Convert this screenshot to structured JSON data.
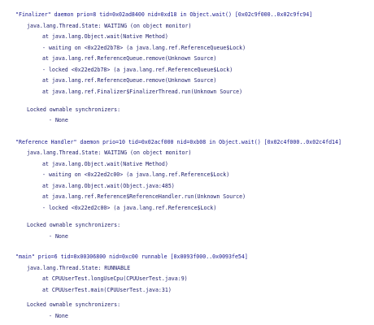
{
  "threads": [
    {
      "header": "\"Finalizer\" daemon prio=8 tid=0x02ad8400 nid=0xd18 in Object.wait() [0x02c9f000..0x02c9fc94]",
      "state": "java.lang.Thread.State: WAITING (on object monitor)",
      "frames": [
        "at java.lang.Object.wait(Native Method)",
        "- waiting on <0x22ed2b78> (a java.lang.ref.ReferenceQueue$Lock)",
        "at java.lang.ref.ReferenceQueue.remove(Unknown Source)",
        "- locked <0x22ed2b78> (a java.lang.ref.ReferenceQueue$Lock)",
        "at java.lang.ref.ReferenceQueue.remove(Unknown Source)",
        "at java.lang.ref.Finalizer$FinalizerThread.run(Unknown Source)"
      ],
      "sync_label": "Locked ownable synchronizers:",
      "sync_value": "- None"
    },
    {
      "header": "\"Reference Handler\" daemon prio=10 tid=0x02acf000 nid=0xb08 in Object.wait() [0x02c4f000..0x02c4fd14]",
      "state": "java.lang.Thread.State: WAITING (on object monitor)",
      "frames": [
        "at java.lang.Object.wait(Native Method)",
        "- waiting on <0x22ed2c00> (a java.lang.ref.Reference$Lock)",
        "at java.lang.Object.wait(Object.java:485)",
        "at java.lang.ref.Reference$ReferenceHandler.run(Unknown Source)",
        "- locked <0x22ed2c00> (a java.lang.ref.Reference$Lock)"
      ],
      "sync_label": "Locked ownable synchronizers:",
      "sync_value": "- None"
    },
    {
      "header": "\"main\" prio=6 tid=0x00306800 nid=0xc00 runnable [0x0093f000..0x0093fe54]",
      "state": "java.lang.Thread.State: RUNNABLE",
      "frames": [
        "at CPUUserTest.longUseCpu(CPUUserTest.java:9)",
        "at CPUUserTest.main(CPUUserTest.java:31)"
      ],
      "sync_label": "Locked ownable synchronizers:",
      "sync_value": "- None"
    }
  ]
}
